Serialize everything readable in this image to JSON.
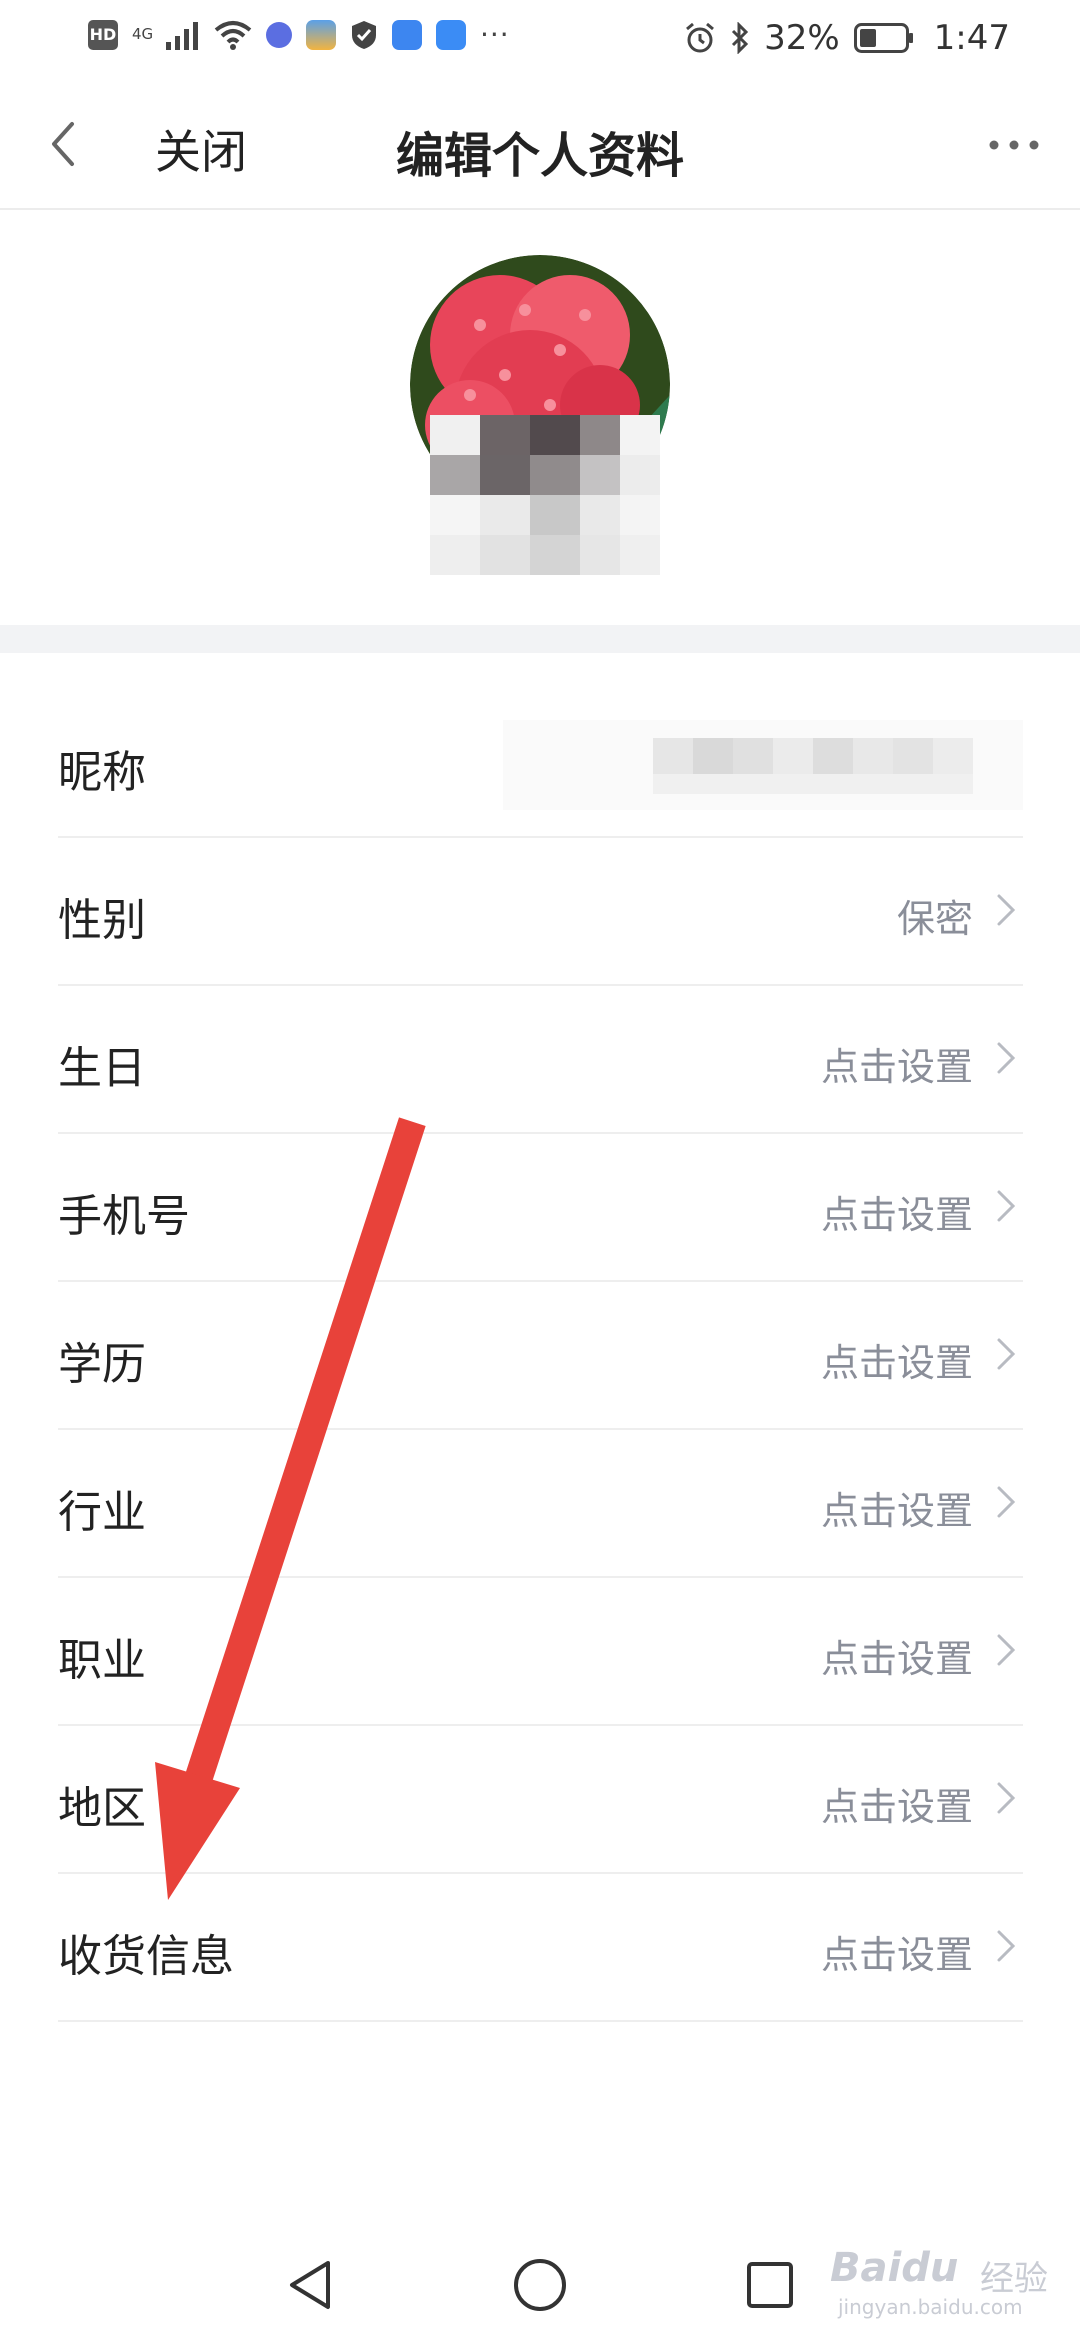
{
  "status_bar": {
    "network_badge": "HD",
    "signal_label": "4G",
    "overflow": "···",
    "battery_percent": "32%",
    "time": "1:47",
    "icons": [
      "hd-icon",
      "signal-icon",
      "wifi-icon",
      "music-app-icon",
      "weather-app-icon",
      "shield-icon",
      "contacts-app-icon",
      "cloud-icon",
      "alarm-icon",
      "bluetooth-icon",
      "battery-icon"
    ]
  },
  "nav": {
    "close_label": "关闭",
    "title": "编辑个人资料"
  },
  "profile": {
    "avatar_icon": "avatar-flower-image"
  },
  "list": {
    "items": [
      {
        "label": "昵称",
        "value": ""
      },
      {
        "label": "性别",
        "value": "保密"
      },
      {
        "label": "生日",
        "value": "点击设置"
      },
      {
        "label": "手机号",
        "value": "点击设置"
      },
      {
        "label": "学历",
        "value": "点击设置"
      },
      {
        "label": "行业",
        "value": "点击设置"
      },
      {
        "label": "职业",
        "value": "点击设置"
      },
      {
        "label": "地区",
        "value": "点击设置"
      },
      {
        "label": "收货信息",
        "value": "点击设置"
      }
    ]
  },
  "colors": {
    "accent_arrow": "#e8423a",
    "secondary_text": "#8a8e99",
    "primary_text": "#222222",
    "divider": "#eeeeee"
  },
  "watermark": {
    "brand": "Baidu",
    "brand_cn": "经验",
    "site": "jingyan.baidu.com"
  }
}
